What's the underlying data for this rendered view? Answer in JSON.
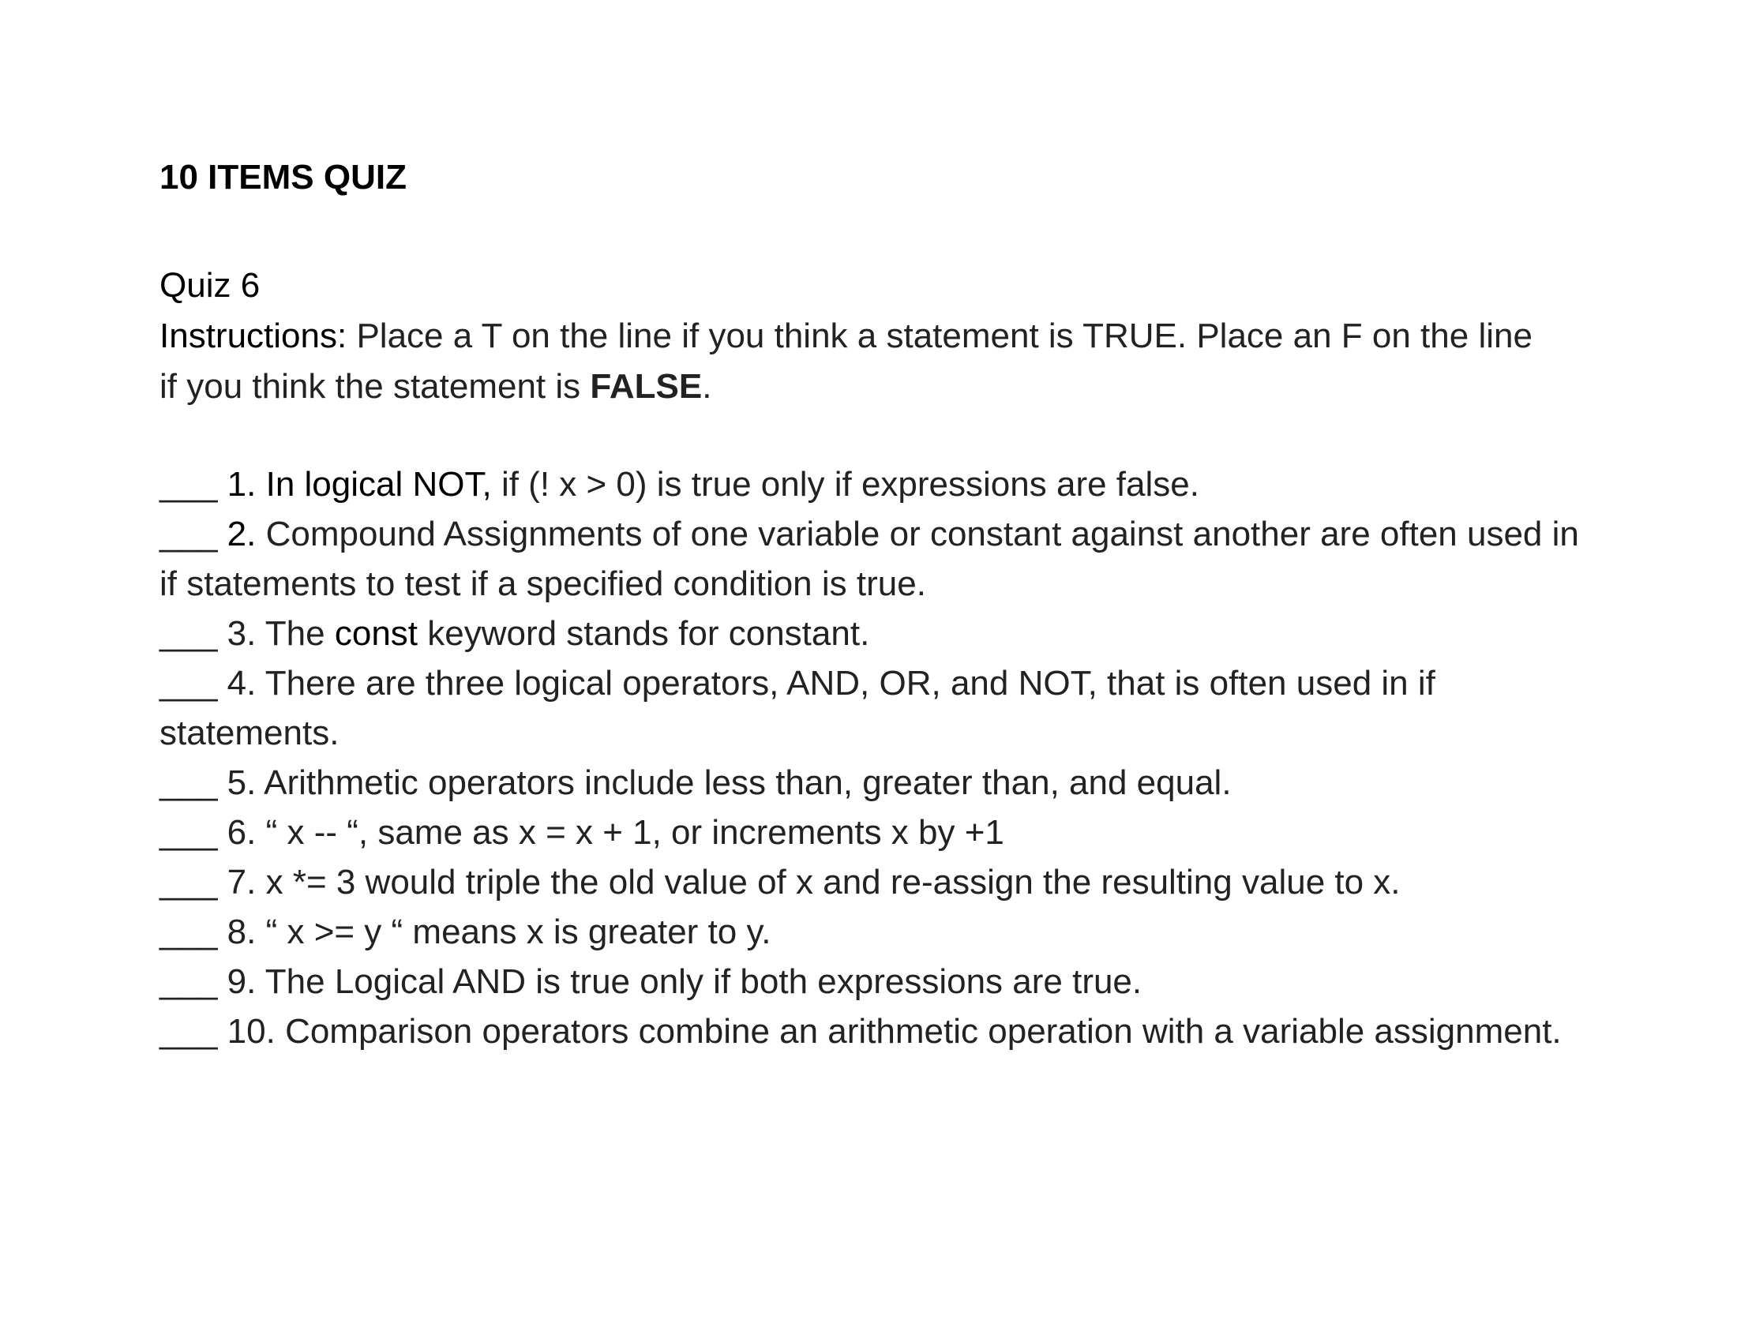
{
  "document": {
    "title": "10 ITEMS QUIZ",
    "quiz_name": "Quiz 6",
    "instructions": {
      "label": "Instructions:",
      "text_before": " Place a T on the line if you think a statement is TRUE. Place an F on the line if you think the statement is ",
      "emphasis": "FALSE",
      "text_after": "."
    },
    "blank": "___",
    "items": [
      {
        "number": "1.",
        "lead": "In logical NOT,",
        "text": "if (! x > 0) is true only if expressions are false."
      },
      {
        "number": "2.",
        "lead": "",
        "text": "Compound Assignments of one variable or constant against another are often used in if statements to test if a specified condition is true."
      },
      {
        "number": "3.",
        "lead": "",
        "text_pre": "The ",
        "keyword": "const",
        "text": " keyword stands for constant."
      },
      {
        "number": "4.",
        "lead": "",
        "text": "There are three logical operators, AND, OR, and NOT, that is often used in if statements."
      },
      {
        "number": "5.",
        "lead": "",
        "text": "Arithmetic operators include less than, greater than, and equal."
      },
      {
        "number": "6.",
        "lead": "",
        "text": "“ x -- “, same as x = x + 1, or increments x by +1"
      },
      {
        "number": "7.",
        "lead": "",
        "text": " x *= 3 would triple the old value of x and re-assign the resulting value to x."
      },
      {
        "number": "8.",
        "lead": "",
        "text": "“ x  >=  y “ means x is greater to y."
      },
      {
        "number": "9.",
        "lead": "",
        "text": " The Logical AND is true only if both expressions are true."
      },
      {
        "number": "10.",
        "lead": "",
        "text": "Comparison operators combine an arithmetic operation with a variable assignment."
      }
    ]
  }
}
